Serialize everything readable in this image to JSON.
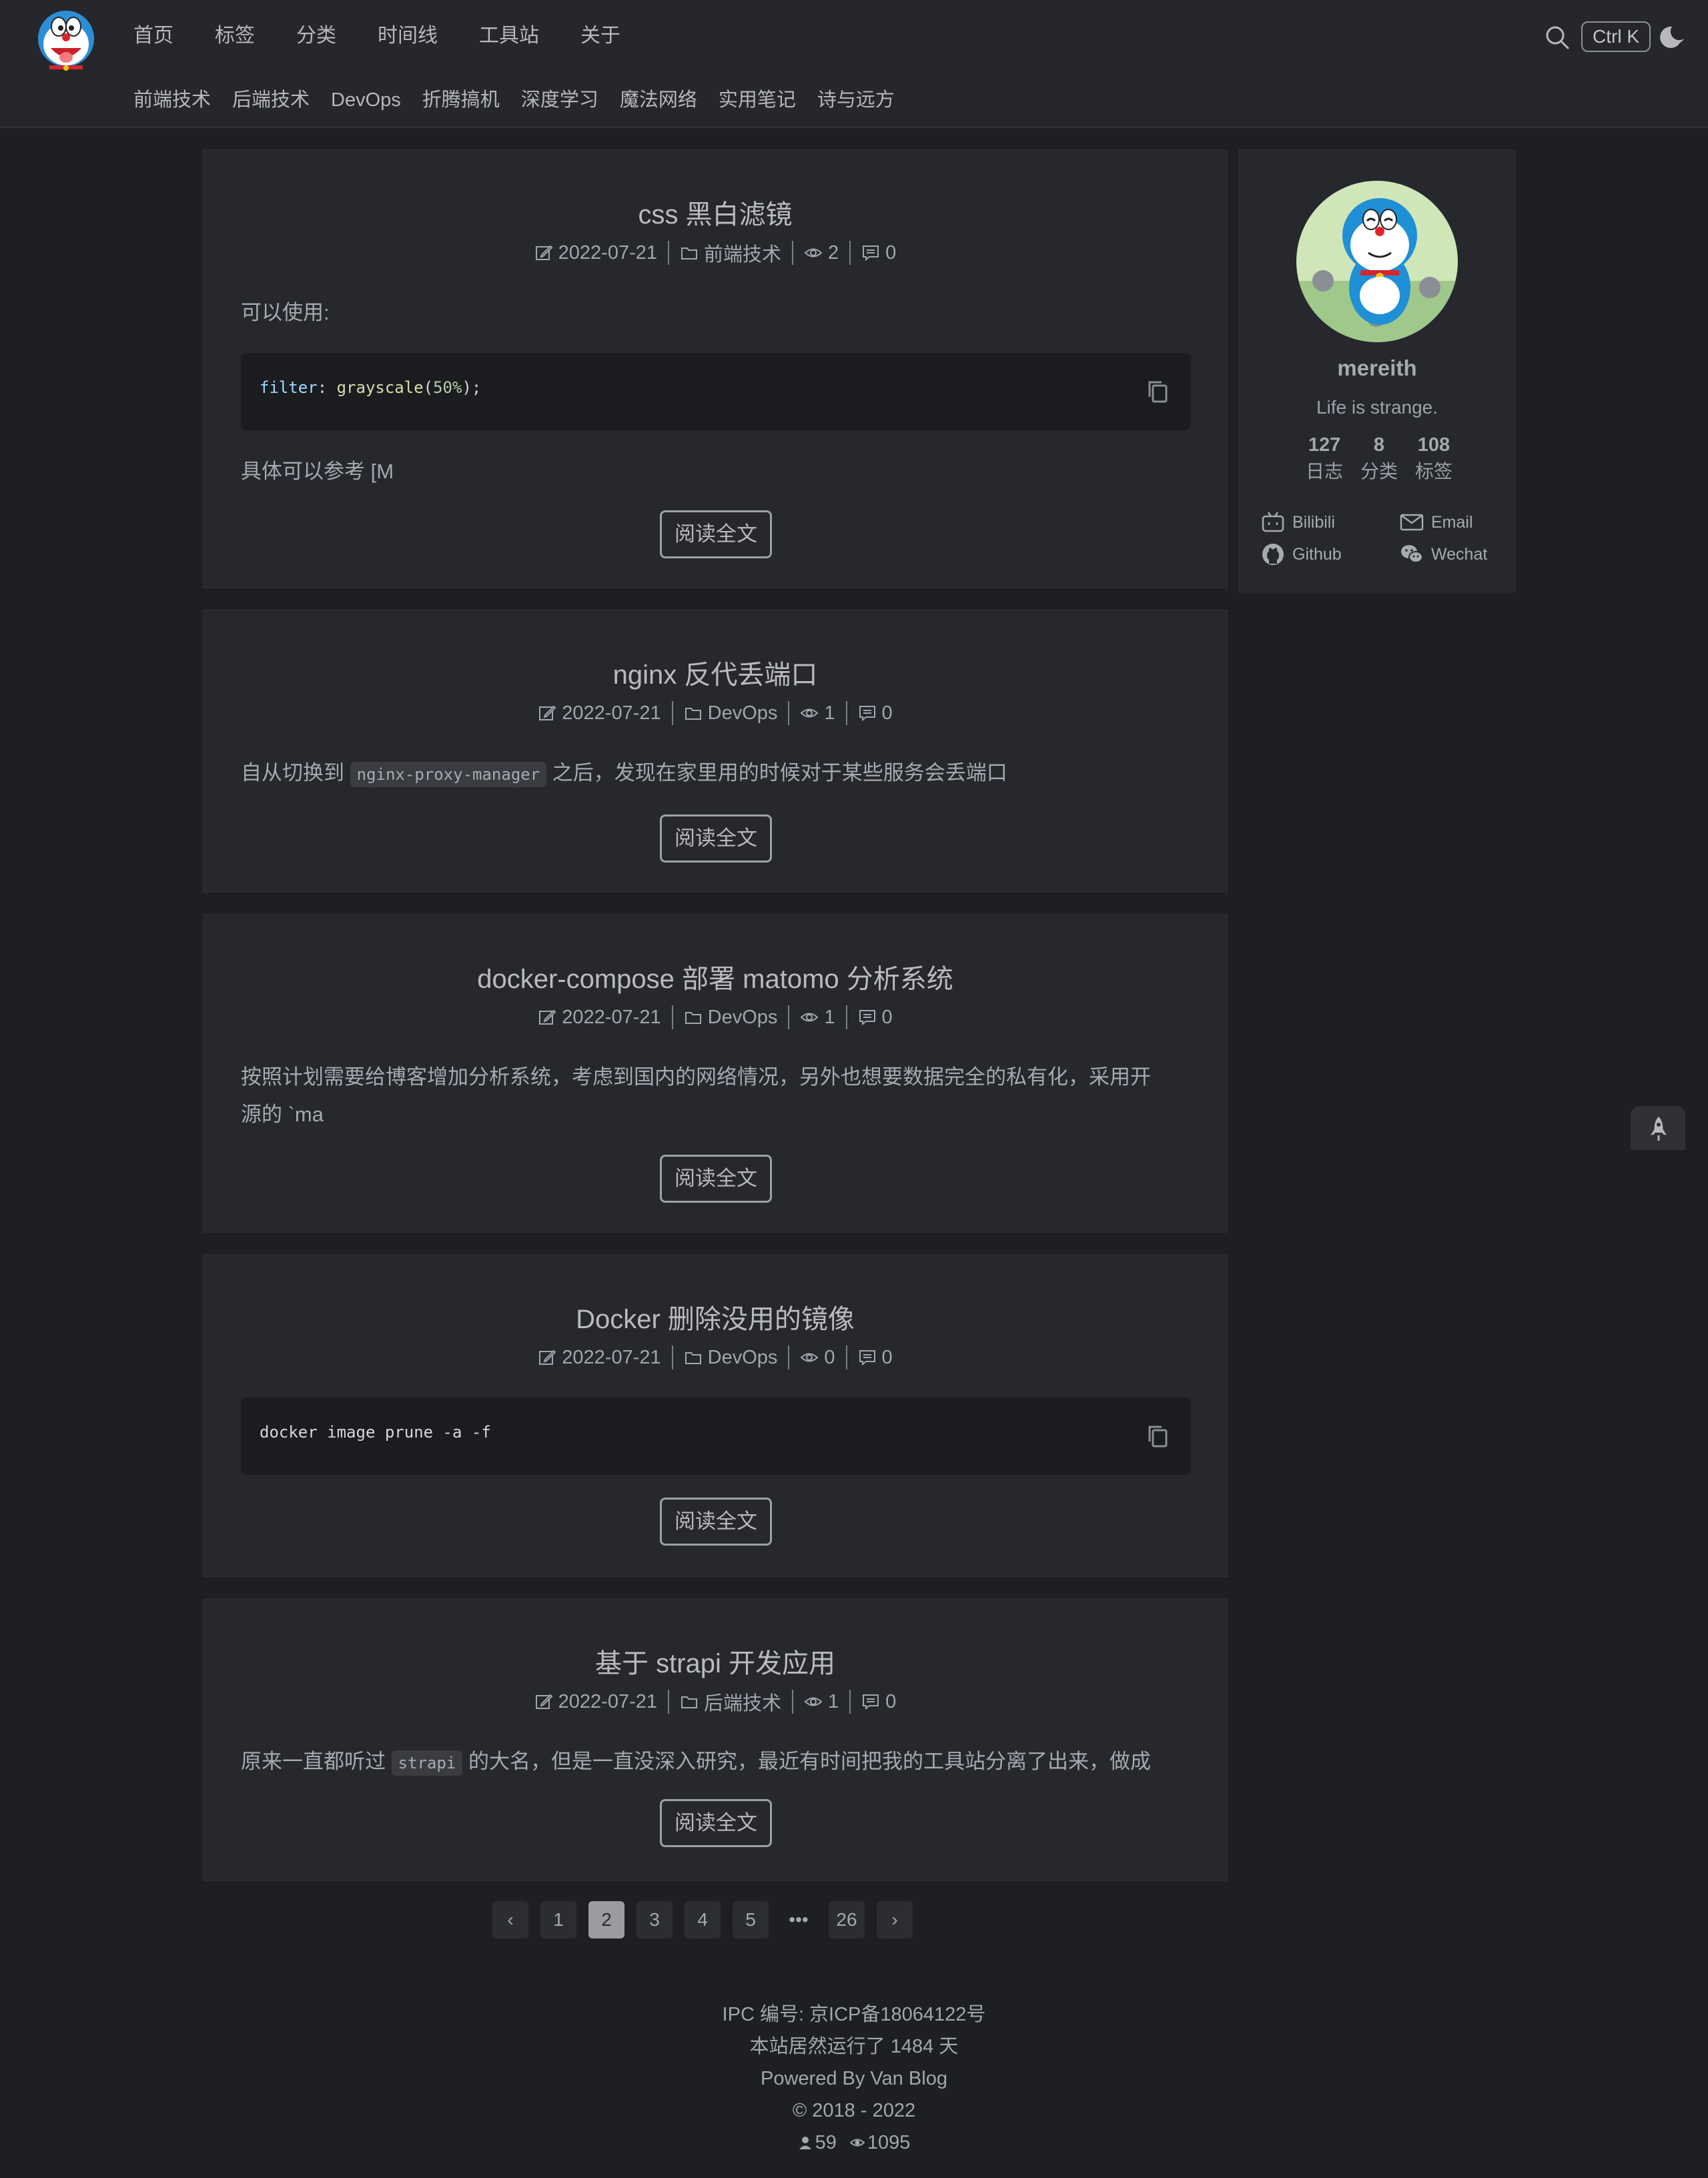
{
  "header": {
    "nav": [
      "首页",
      "标签",
      "分类",
      "时间线",
      "工具站",
      "关于"
    ],
    "categories": [
      "前端技术",
      "后端技术",
      "DevOps",
      "折腾搞机",
      "深度学习",
      "魔法网络",
      "实用笔记",
      "诗与远方"
    ],
    "search_shortcut": "Ctrl K",
    "icons": [
      "doraemon-logo",
      "search-icon",
      "moon-icon"
    ]
  },
  "posts": [
    {
      "title": "css 黑白滤镜",
      "date": "2022-07-21",
      "category": "前端技术",
      "views": "2",
      "comments": "0",
      "excerpt": "可以使用:",
      "code": "filter: grayscale(50%);",
      "code_parts": {
        "prop": "filter",
        "colon": ": ",
        "fn": "grayscale",
        "open": "(",
        "num": "50%",
        "close": ");"
      },
      "excerpt_after": "具体可以参考 [M",
      "read_more": "阅读全文"
    },
    {
      "title": "nginx 反代丢端口",
      "date": "2022-07-21",
      "category": "DevOps",
      "views": "1",
      "comments": "0",
      "excerpt_before": "自从切换到",
      "inline_code": "nginx-proxy-manager",
      "excerpt_after": "之后，发现在家里用的时候对于某些服务会丢端口",
      "read_more": "阅读全文"
    },
    {
      "title": "docker-compose 部署 matomo 分析系统",
      "date": "2022-07-21",
      "category": "DevOps",
      "views": "1",
      "comments": "0",
      "excerpt_line1": "按照计划需要给博客增加分析系统，考虑到国内的网络情况，另外也想要数据完全的私有化，采用开",
      "excerpt_line2": "源的 `ma",
      "read_more": "阅读全文"
    },
    {
      "title": "Docker 删除没用的镜像",
      "date": "2022-07-21",
      "category": "DevOps",
      "views": "0",
      "comments": "0",
      "code": "docker image prune -a -f",
      "read_more": "阅读全文"
    },
    {
      "title": "基于 strapi 开发应用",
      "date": "2022-07-21",
      "category": "后端技术",
      "views": "1",
      "comments": "0",
      "excerpt_before": "原来一直都听过",
      "inline_code": "strapi",
      "excerpt_after": "的大名，但是一直没深入研究，最近有时间把我的工具站分离了出来，做成",
      "read_more": "阅读全文"
    }
  ],
  "sidebar": {
    "name": "mereith",
    "description": "Life is strange.",
    "stats": [
      {
        "num": "127",
        "label": "日志"
      },
      {
        "num": "8",
        "label": "分类"
      },
      {
        "num": "108",
        "label": "标签"
      }
    ],
    "links": [
      "Bilibili",
      "Email",
      "Github",
      "Wechat"
    ]
  },
  "pagination": {
    "prev": "‹",
    "pages": [
      "1",
      "2",
      "3",
      "4",
      "5"
    ],
    "current": "2",
    "ellipsis": "•••",
    "last": "26",
    "next": "›"
  },
  "footer": {
    "ipc": "IPC 编号: 京ICP备18064122号",
    "running": "本站居然运行了 1484 天",
    "powered": "Powered By Van Blog",
    "copyright": "© 2018 - 2022",
    "visitors": "59",
    "page_views": "1095"
  }
}
